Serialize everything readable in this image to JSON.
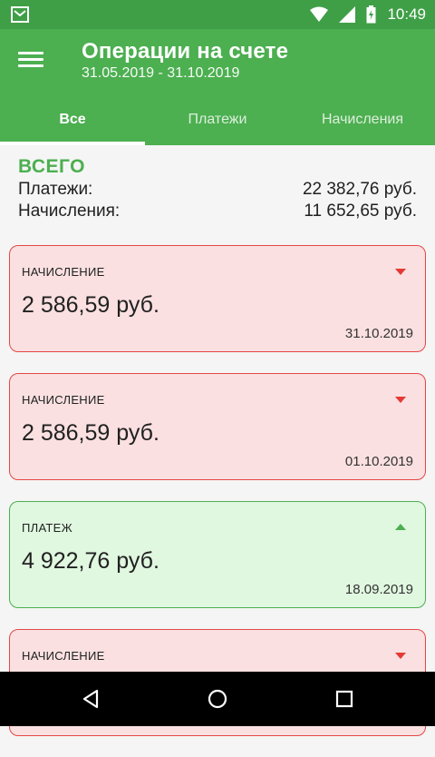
{
  "status_bar": {
    "time": "10:49"
  },
  "app_bar": {
    "title": "Операции на счете",
    "subtitle": "31.05.2019 - 31.10.2019"
  },
  "tabs": [
    {
      "label": "Все",
      "active": true
    },
    {
      "label": "Платежи",
      "active": false
    },
    {
      "label": "Начисления",
      "active": false
    }
  ],
  "summary": {
    "heading": "ВСЕГО",
    "payments_label": "Платежи:",
    "payments_value": "22 382,76 руб.",
    "charges_label": "Начисления:",
    "charges_value": "11 652,65 руб."
  },
  "operations": [
    {
      "type": "НАЧИСЛЕНИЕ",
      "amount": "2 586,59 руб.",
      "date": "31.10.2019",
      "kind": "charge"
    },
    {
      "type": "НАЧИСЛЕНИЕ",
      "amount": "2 586,59 руб.",
      "date": "01.10.2019",
      "kind": "charge"
    },
    {
      "type": "ПЛАТЕЖ",
      "amount": "4 922,76 руб.",
      "date": "18.09.2019",
      "kind": "payment"
    },
    {
      "type": "НАЧИСЛЕНИЕ",
      "amount": "",
      "date": "",
      "kind": "charge"
    }
  ],
  "colors": {
    "primary": "#4caf50",
    "status_bar": "#3f9f47",
    "charge_border": "#e34848",
    "charge_bg": "#fae0e0",
    "payment_bg": "#e0f7e0"
  }
}
